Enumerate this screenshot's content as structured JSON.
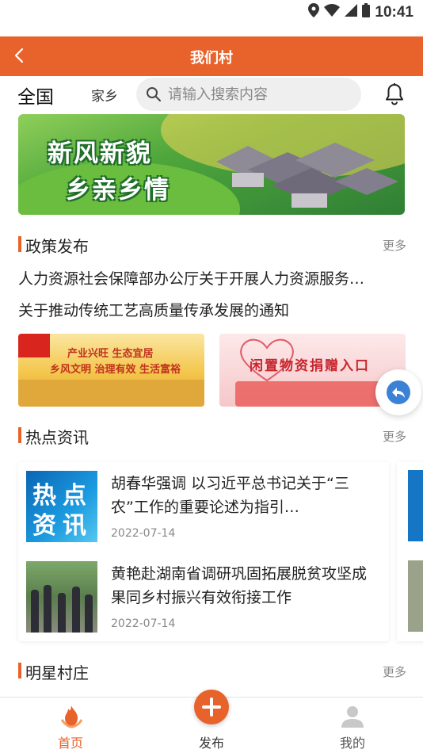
{
  "status_bar": {
    "time": "10:41",
    "icons": [
      "location-icon",
      "wifi-icon",
      "signal-icon",
      "battery-icon"
    ]
  },
  "app_bar": {
    "title": "我们村",
    "back_icon": "chevron-left-icon",
    "color": "#e8632b"
  },
  "search_row": {
    "region": "全国",
    "hometown": "家乡",
    "search_placeholder": "请输入搜索内容",
    "bell_icon": "bell-icon"
  },
  "banner": {
    "line1": "新风新貌",
    "line2": "乡亲乡情"
  },
  "policy": {
    "title": "政策发布",
    "more": "更多",
    "items": [
      "人力资源社会保障部办公厅关于开展人力资源服务…",
      "关于推动传统工艺高质量传承发展的通知"
    ]
  },
  "promos": [
    {
      "line1": "产业兴旺  生态宜居",
      "line2": "乡风文明  治理有效  生活富裕"
    },
    {
      "text": "闲置物资捐赠入口"
    }
  ],
  "hot_news": {
    "title": "热点资讯",
    "more": "更多",
    "thumb_text": [
      "热",
      "点",
      "资",
      "讯"
    ],
    "items": [
      {
        "title": "胡春华强调 以习近平总书记关于“三农”工作的重要论述为指引…",
        "date": "2022-07-14"
      },
      {
        "title": "黄艳赴湖南省调研巩固拓展脱贫攻坚成果同乡村振兴有效衔接工作",
        "date": "2022-07-14"
      }
    ]
  },
  "star_village": {
    "title": "明星村庄",
    "more": "更多"
  },
  "tab_bar": {
    "tabs": [
      {
        "label": "首页",
        "icon": "home-flame-icon",
        "active": true
      },
      {
        "label": "发布",
        "icon": "plus-icon",
        "active": false
      },
      {
        "label": "我的",
        "icon": "user-icon",
        "active": false
      }
    ],
    "active_color": "#e8632b"
  }
}
